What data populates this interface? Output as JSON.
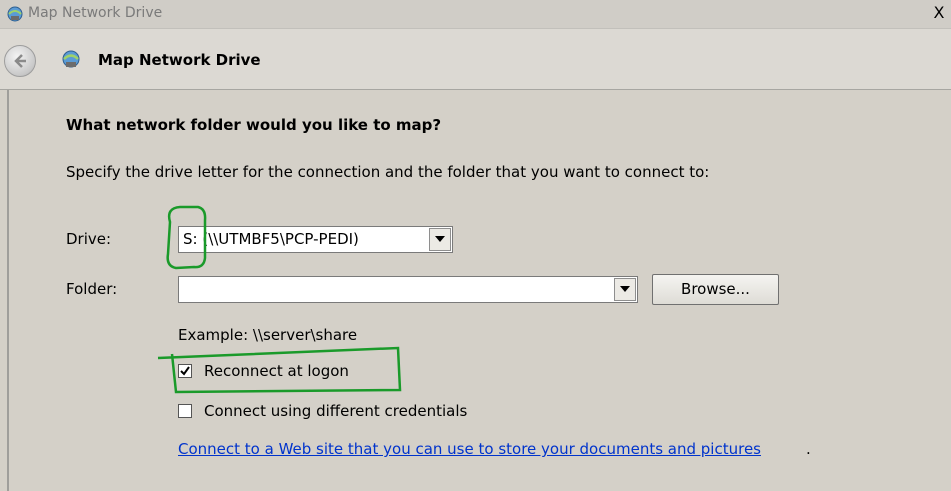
{
  "window": {
    "title": "Map Network Drive",
    "close_label": "X"
  },
  "nav": {
    "title": "Map Network Drive"
  },
  "content": {
    "heading": "What network folder would you like to map?",
    "instruction": "Specify the drive letter for the connection and the folder that you want to connect to:",
    "drive_label": "Drive:",
    "drive_value": "S: (\\\\UTMBF5\\PCP-PEDI)",
    "folder_label": "Folder:",
    "folder_value": "",
    "browse_label": "Browse...",
    "example_text": "Example: \\\\server\\share",
    "reconnect_label": "Reconnect at logon",
    "reconnect_checked": true,
    "credentials_label": "Connect using different credentials",
    "credentials_checked": false,
    "web_link": "Connect to a Web site that you can use to store your documents and pictures",
    "link_suffix": "."
  },
  "colors": {
    "background": "#d4d0c8",
    "link": "#0033cc",
    "annotation": "#1a9a2a"
  },
  "icons": [
    "network-drive-icon",
    "back-arrow-icon",
    "chevron-down-icon",
    "checkmark-icon"
  ]
}
